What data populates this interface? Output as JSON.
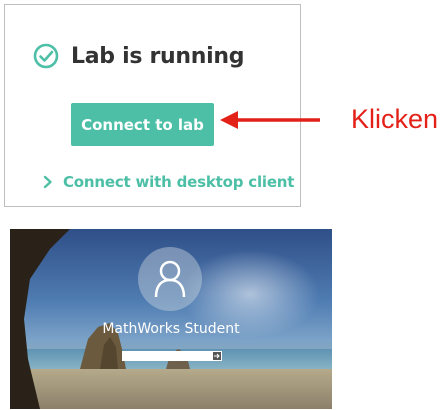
{
  "colors": {
    "accent": "#4cbfa6",
    "text_dark": "#333333",
    "annotation_red": "#e32119",
    "card_border": "#bfbfbf"
  },
  "lab_card": {
    "status_icon": "check-circle-icon",
    "status_text": "Lab is running",
    "connect_button_label": "Connect to lab",
    "desktop_link_icon": "chevron-right-icon",
    "desktop_link_label": "Connect with desktop client"
  },
  "annotation": {
    "label": "Klicken",
    "icon": "arrow-left-icon"
  },
  "login_screen": {
    "avatar_icon": "user-icon",
    "username": "MathWorks Student",
    "password_value": "",
    "submit_icon": "arrow-right-icon"
  }
}
